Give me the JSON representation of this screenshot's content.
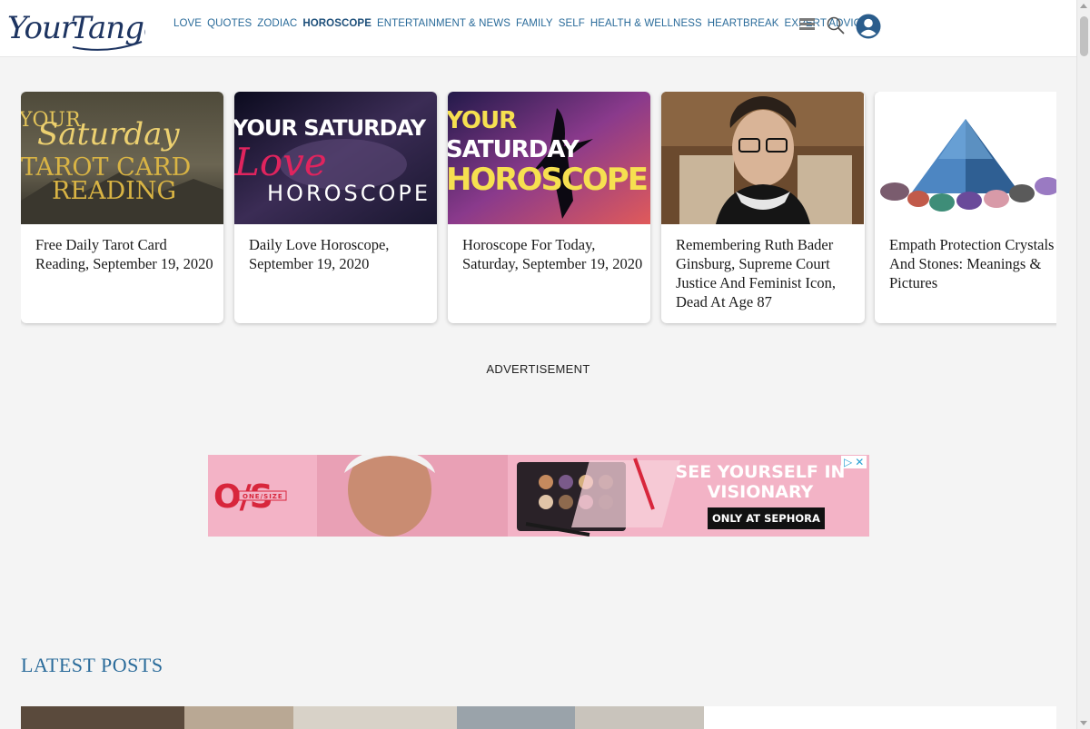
{
  "brand": {
    "logo_text": "Your Tango"
  },
  "nav": {
    "items": [
      {
        "label": "LOVE",
        "active": false
      },
      {
        "label": "QUOTES",
        "active": false
      },
      {
        "label": "ZODIAC",
        "active": false
      },
      {
        "label": "HOROSCOPE",
        "active": true
      },
      {
        "label": "ENTERTAINMENT & NEWS",
        "active": false
      },
      {
        "label": "FAMILY",
        "active": false
      },
      {
        "label": "SELF",
        "active": false
      },
      {
        "label": "HEALTH & WELLNESS",
        "active": false
      },
      {
        "label": "HEARTBREAK",
        "active": false
      },
      {
        "label": "EXPERT ADVICE",
        "active": false
      }
    ],
    "icons": [
      "menu-icon",
      "search-icon",
      "user-account-icon"
    ]
  },
  "cards": [
    {
      "title": "Free Daily Tarot Card Reading, September 19, 2020",
      "image_text": [
        "YOUR",
        "Saturday",
        "TAROT CARD",
        "READING"
      ]
    },
    {
      "title": "Daily Love Horoscope, September 19, 2020",
      "image_text": [
        "YOUR SATURDAY",
        "Love",
        "HOROSCOPE"
      ]
    },
    {
      "title": "Horoscope For Today, Saturday, September 19, 2020",
      "image_text": [
        "YOUR",
        "SATURDAY",
        "HOROSCOPE"
      ]
    },
    {
      "title": "Remembering Ruth Bader Ginsburg, Supreme Court Justice And Feminist Icon, Dead At Age 87",
      "image_text": []
    },
    {
      "title": "Empath Protection Crystals And Stones: Meanings & Pictures",
      "image_text": []
    }
  ],
  "advertisement": {
    "label": "ADVERTISEMENT",
    "brand_logo": "ONE/SIZE",
    "headline": "SEE YOURSELF IN VISIONARY",
    "cta": "ONLY AT SEPHORA"
  },
  "latest": {
    "title": "LATEST POSTS"
  },
  "colors": {
    "accent": "#2a6b9a",
    "logo": "#1d3461",
    "background": "#f4f4f4"
  }
}
